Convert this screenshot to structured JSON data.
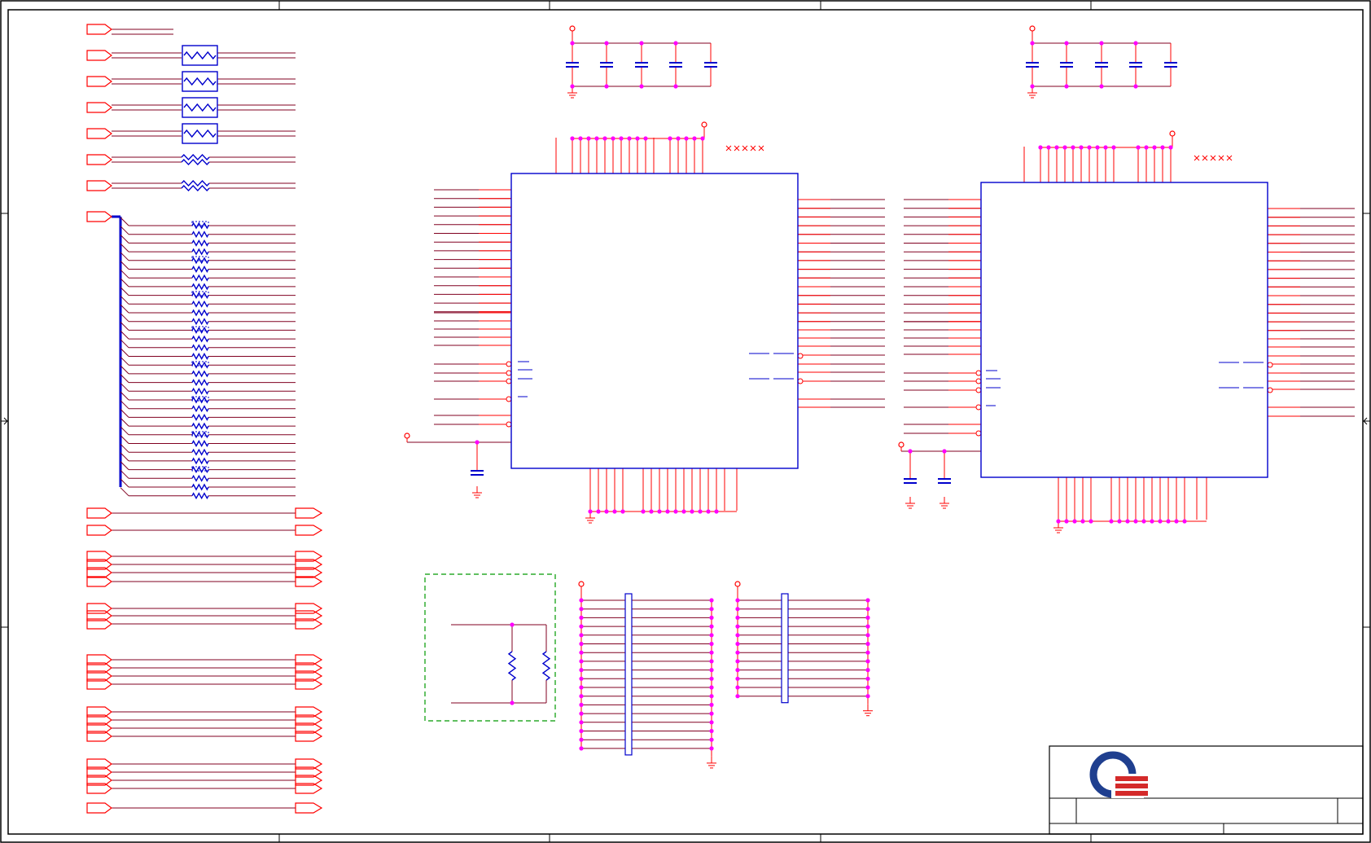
{
  "sheet": {
    "title": "",
    "colors": {
      "frame": "#000000",
      "wire": "#800020",
      "pin": "#ff0000",
      "part": "#0000cc",
      "junction": "#ff00ff",
      "group_box": "#009900",
      "logo_blue": "#1f3f8f",
      "logo_red": "#d42a2a"
    }
  },
  "components": {
    "off_sheet_ports": 48,
    "ferrite_beads": 4,
    "series_resistors_single": 2,
    "series_resistor_array_count": 32,
    "ic_chips": 2,
    "decoupling_banks": 2,
    "capacitors_per_bank": 5,
    "filter_network_resistors": 2,
    "pull_resistor_networks": 2
  },
  "title_block": {
    "logo": "company-logo",
    "title": "",
    "rev": "",
    "sheet": ""
  }
}
